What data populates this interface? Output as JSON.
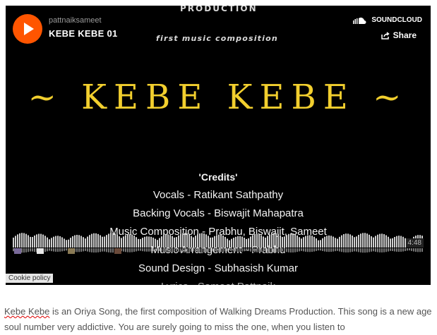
{
  "player": {
    "top_text": "PRODUCTION",
    "subtitle": "first music composition",
    "username": "pattnaiksameet",
    "track_title": "KEBE KEBE 01",
    "soundcloud_label": "SOUNDCLOUD",
    "share_label": "Share",
    "artwork_title": "~ KEBE KEBE ~",
    "credits": [
      "'Credits'",
      "Vocals - Ratikant Sathpathy",
      "Backing Vocals - Biswajit Mahapatra",
      "Music Composition - Prabhu, Biswajit, Sameet",
      "Music Arrangement - Prabhu",
      "Sound Design - Subhasish Kumar",
      "Lyrics - Sameet Pattnaik"
    ],
    "duration": "4:48",
    "cookie_policy": "Cookie policy"
  },
  "description": {
    "first_word": "Kebe Kebe",
    "text": " is an Oriya Song, the first composition of Walking Dreams Production. This song is a new age soul number very addictive. You are surely going to miss the one, when you listen to"
  },
  "colors": {
    "accent": "#ff5500",
    "title_gold": "#f2cf2e"
  }
}
